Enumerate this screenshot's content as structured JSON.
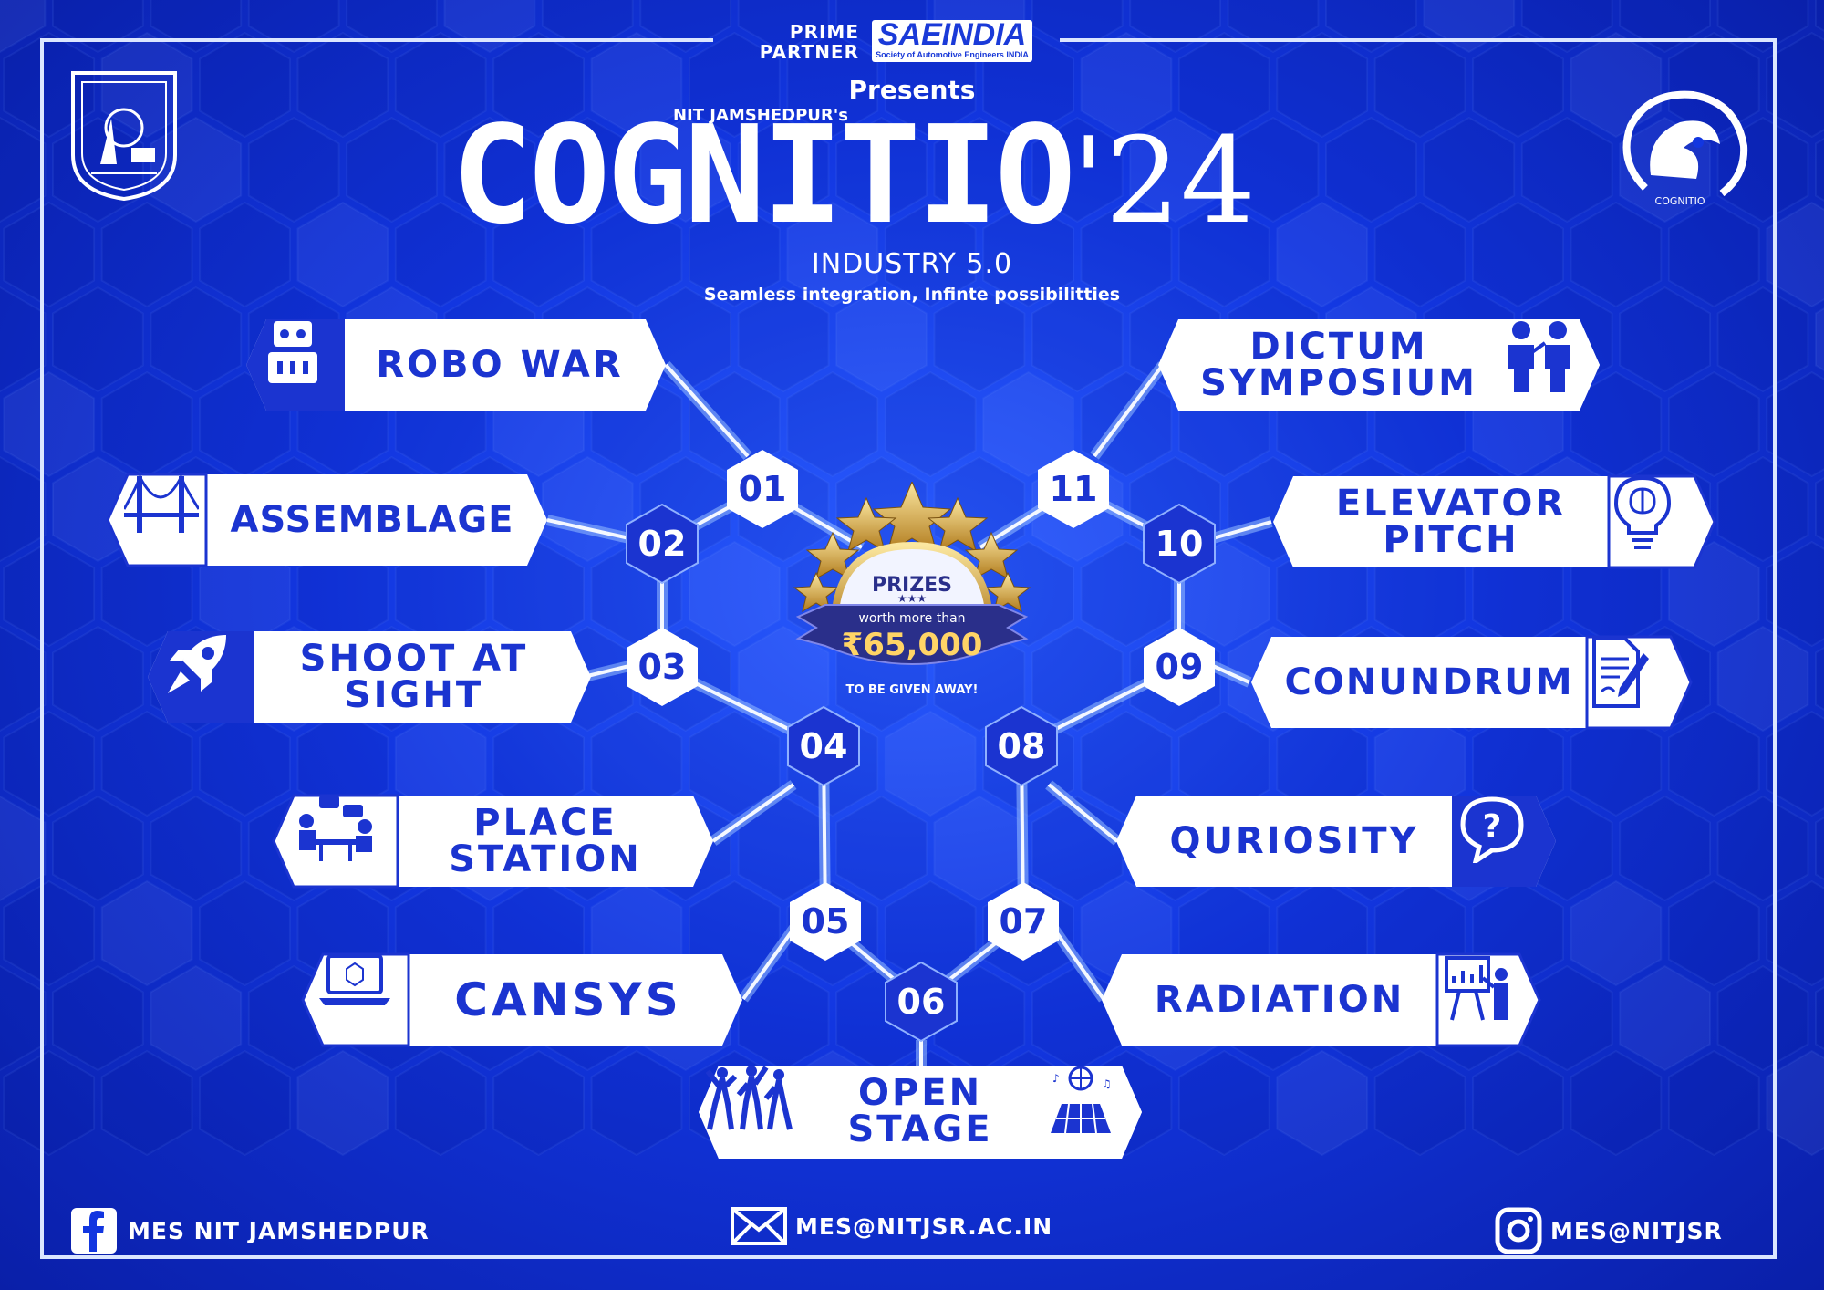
{
  "header": {
    "prime_partner": "PRIME PARTNER",
    "partner_name": "SAEINDIA",
    "partner_sub": "Society of Automotive Engineers INDIA",
    "presents": "Presents",
    "organizer": "NIT JAMSHEDPUR's",
    "title": "COGNITIO",
    "year": "'24",
    "theme": "INDUSTRY 5.0",
    "tagline": "Seamless integration, Infinte possibilitties"
  },
  "logos": {
    "left": "NATIONAL INSTITUTE OF TECHNOLOGY JAMSHEDPUR",
    "right": "COGNITIO"
  },
  "prize": {
    "label": "PRIZES",
    "prefix": "worth more than",
    "amount": "₹65,000",
    "suffix": "TO BE GIVEN AWAY!"
  },
  "events": [
    {
      "num": "01",
      "name": "ROBO WAR",
      "icon": "robot-icon"
    },
    {
      "num": "02",
      "name": "ASSEMBLAGE",
      "icon": "bridge-icon"
    },
    {
      "num": "03",
      "name": "SHOOT AT SIGHT",
      "icon": "rocket-icon"
    },
    {
      "num": "04",
      "name": "PLACE STATION",
      "icon": "interview-icon"
    },
    {
      "num": "05",
      "name": "CANSYS",
      "icon": "laptop-icon"
    },
    {
      "num": "06",
      "name": "OPEN STAGE",
      "icon": "dancers-icon"
    },
    {
      "num": "07",
      "name": "RADIATION",
      "icon": "presentation-icon"
    },
    {
      "num": "08",
      "name": "QURIOSITY",
      "icon": "question-bubble-icon"
    },
    {
      "num": "09",
      "name": "CONUNDRUM",
      "icon": "document-pen-icon"
    },
    {
      "num": "10",
      "name": "ELEVATOR PITCH",
      "icon": "lightbulb-icon"
    },
    {
      "num": "11",
      "name": "DICTUM SYMPOSIUM",
      "icon": "debate-icon"
    }
  ],
  "footer": {
    "facebook": "MES NIT JAMSHEDPUR",
    "email": "MES@NITJSR.AC.IN",
    "instagram": "MES@NITJSR"
  },
  "colors": {
    "primary": "#1b34d0",
    "background": "#1236e0",
    "white": "#ffffff"
  }
}
